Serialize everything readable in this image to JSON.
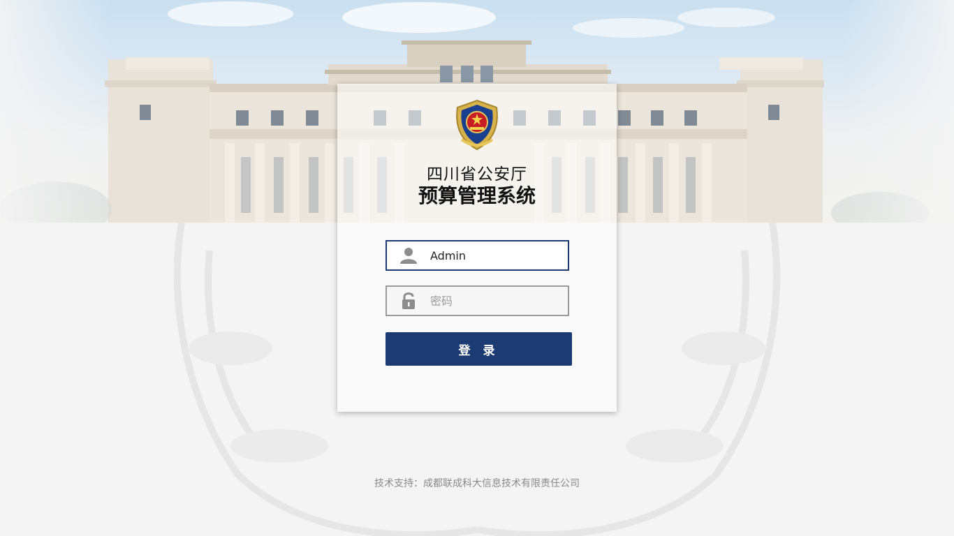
{
  "login": {
    "title_line1": "四川省公安厅",
    "title_line2": "预算管理系统",
    "username_value": "Admin",
    "password_placeholder": "密码",
    "submit_label": "登 录"
  },
  "footer": {
    "text": "技术支持：成都联成科大信息技术有限责任公司"
  },
  "colors": {
    "primary": "#1c3b73",
    "input_border_active": "#1d3a72",
    "input_border": "#9a9a9a",
    "footer_text": "#8a8a8a",
    "page_background": "#f4f4f4"
  },
  "icons": {
    "emblem": "police-emblem-icon",
    "username": "user-icon",
    "password": "lock-icon"
  }
}
